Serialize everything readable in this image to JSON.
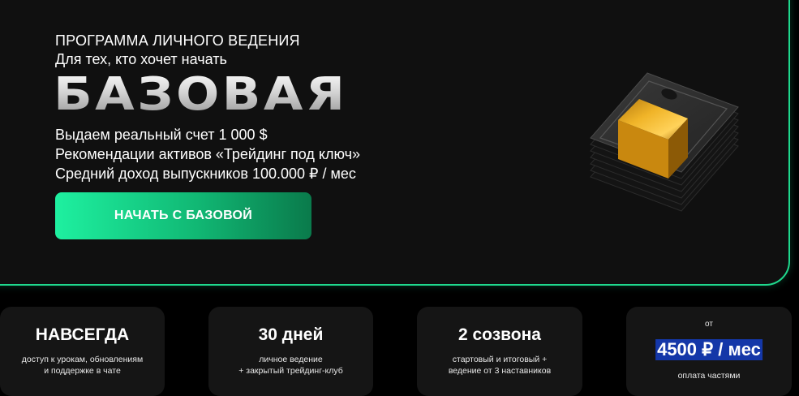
{
  "hero": {
    "eyebrow": "ПРОГРАММА ЛИЧНОГО ВЕДЕНИЯ",
    "subtitle": "Для тех, кто хочет начать",
    "title": "БАЗОВАЯ",
    "features": [
      "Выдаем реальный счет 1 000 $",
      "Рекомендации активов «Трейдинг под ключ»",
      "Средний доход выпускников 100.000 ₽ / мес"
    ],
    "cta_label": "НАЧАТЬ С БАЗОВОЙ",
    "image_icon": "money-stack-icon"
  },
  "cards": [
    {
      "title": "НАВСЕГДА",
      "lines": [
        "доступ к урокам, обновлениям",
        "и поддержке в чате"
      ]
    },
    {
      "title": "30 дней",
      "lines": [
        "личное ведение",
        "+ закрытый трейдинг-клуб"
      ]
    },
    {
      "title": "2 созвона",
      "lines": [
        "стартовый и итоговый +",
        "ведение от 3 наставников"
      ]
    }
  ],
  "price": {
    "prefix": "от",
    "value": "4500 ₽ / мес",
    "note": "оплата частями"
  },
  "colors": {
    "accent_green": "#1fd88d",
    "hero_background": "#101010",
    "card_background": "#151515",
    "price_highlight": "#1437a8",
    "band_gold": "#e0a21a"
  }
}
